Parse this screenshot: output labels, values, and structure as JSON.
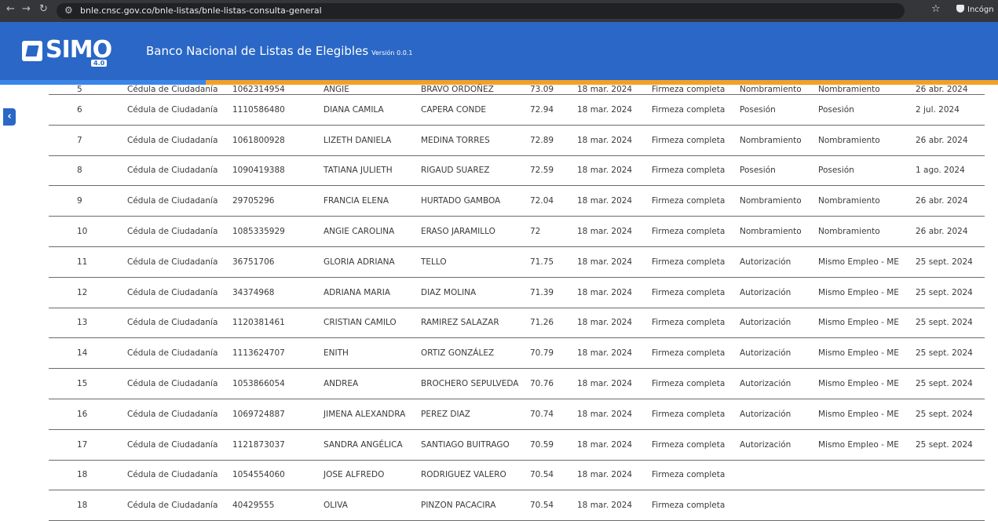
{
  "browser": {
    "url": "bnle.cnsc.gov.co/bnle-listas/bnle-listas-consulta-general",
    "profile_label": "Incógn"
  },
  "header": {
    "logo_text": "SIMO",
    "logo_version": "4.0",
    "title": "Banco Nacional de Listas de Elegibles",
    "version": "Versión 0.0.1"
  },
  "table": {
    "rows": [
      [
        "5",
        "Cédula de Ciudadanía",
        "1062314954",
        "ANGIE",
        "BRAVO ORDOÑEZ",
        "73.09",
        "18 mar. 2024",
        "Firmeza completa",
        "Nombramiento",
        "Nombramiento",
        "26 abr. 2024"
      ],
      [
        "6",
        "Cédula de Ciudadanía",
        "1110586480",
        "DIANA CAMILA",
        "CAPERA CONDE",
        "72.94",
        "18 mar. 2024",
        "Firmeza completa",
        "Posesión",
        "Posesión",
        "2 jul. 2024"
      ],
      [
        "7",
        "Cédula de Ciudadanía",
        "1061800928",
        "LIZETH DANIELA",
        "MEDINA TORRES",
        "72.89",
        "18 mar. 2024",
        "Firmeza completa",
        "Nombramiento",
        "Nombramiento",
        "26 abr. 2024"
      ],
      [
        "8",
        "Cédula de Ciudadanía",
        "1090419388",
        "TATIANA JULIETH",
        "RIGAUD SUAREZ",
        "72.59",
        "18 mar. 2024",
        "Firmeza completa",
        "Posesión",
        "Posesión",
        "1 ago. 2024"
      ],
      [
        "9",
        "Cédula de Ciudadanía",
        "29705296",
        "FRANCIA ELENA",
        "HURTADO GAMBOA",
        "72.04",
        "18 mar. 2024",
        "Firmeza completa",
        "Nombramiento",
        "Nombramiento",
        "26 abr. 2024"
      ],
      [
        "10",
        "Cédula de Ciudadanía",
        "1085335929",
        "ANGIE CAROLINA",
        "ERASO JARAMILLO",
        "72",
        "18 mar. 2024",
        "Firmeza completa",
        "Nombramiento",
        "Nombramiento",
        "26 abr. 2024"
      ],
      [
        "11",
        "Cédula de Ciudadanía",
        "36751706",
        "GLORIA ADRIANA",
        "TELLO",
        "71.75",
        "18 mar. 2024",
        "Firmeza completa",
        "Autorización",
        "Mismo Empleo - ME",
        "25 sept. 2024"
      ],
      [
        "12",
        "Cédula de Ciudadanía",
        "34374968",
        "ADRIANA MARIA",
        "DIAZ MOLINA",
        "71.39",
        "18 mar. 2024",
        "Firmeza completa",
        "Autorización",
        "Mismo Empleo - ME",
        "25 sept. 2024"
      ],
      [
        "13",
        "Cédula de Ciudadanía",
        "1120381461",
        "CRISTIAN CAMILO",
        "RAMIREZ SALAZAR",
        "71.26",
        "18 mar. 2024",
        "Firmeza completa",
        "Autorización",
        "Mismo Empleo - ME",
        "25 sept. 2024"
      ],
      [
        "14",
        "Cédula de Ciudadanía",
        "1113624707",
        "ENITH",
        "ORTIZ GONZÁLEZ",
        "70.79",
        "18 mar. 2024",
        "Firmeza completa",
        "Autorización",
        "Mismo Empleo - ME",
        "25 sept. 2024"
      ],
      [
        "15",
        "Cédula de Ciudadanía",
        "1053866054",
        "ANDREA",
        "BROCHERO SEPULVEDA",
        "70.76",
        "18 mar. 2024",
        "Firmeza completa",
        "Autorización",
        "Mismo Empleo - ME",
        "25 sept. 2024"
      ],
      [
        "16",
        "Cédula de Ciudadanía",
        "1069724887",
        "JIMENA ALEXANDRA",
        "PEREZ DIAZ",
        "70.74",
        "18 mar. 2024",
        "Firmeza completa",
        "Autorización",
        "Mismo Empleo - ME",
        "25 sept. 2024"
      ],
      [
        "17",
        "Cédula de Ciudadanía",
        "1121873037",
        "SANDRA ANGÉLICA",
        "SANTIAGO BUITRAGO",
        "70.59",
        "18 mar. 2024",
        "Firmeza completa",
        "Autorización",
        "Mismo Empleo - ME",
        "25 sept. 2024"
      ],
      [
        "18",
        "Cédula de Ciudadanía",
        "1054554060",
        "JOSE ALFREDO",
        "RODRIGUEZ VALERO",
        "70.54",
        "18 mar. 2024",
        "Firmeza completa",
        "",
        "",
        ""
      ],
      [
        "18",
        "Cédula de Ciudadanía",
        "40429555",
        "OLIVA",
        "PINZON PACACIRA",
        "70.54",
        "18 mar. 2024",
        "Firmeza completa",
        "",
        "",
        ""
      ]
    ]
  }
}
